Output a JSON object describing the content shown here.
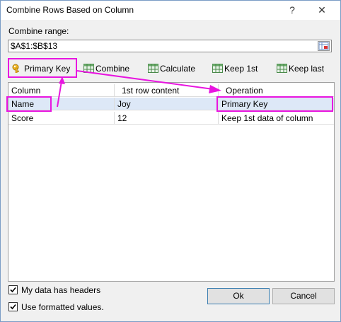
{
  "window": {
    "title": "Combine Rows Based on Column",
    "help": "?",
    "close": "✕"
  },
  "range": {
    "label": "Combine range:",
    "value": "$A$1:$B$13"
  },
  "toolbar": {
    "primary_key": "Primary Key",
    "combine": "Combine",
    "calculate": "Calculate",
    "keep_first": "Keep 1st",
    "keep_last": "Keep last"
  },
  "table": {
    "headers": [
      "Column",
      "1st row content",
      "Operation"
    ],
    "rows": [
      [
        "Name",
        "Joy",
        "Primary Key"
      ],
      [
        "Score",
        "12",
        "Keep 1st data of column"
      ]
    ]
  },
  "options": {
    "headers_label": "My data has headers",
    "headers_checked": true,
    "formatted_label": "Use formatted values.",
    "formatted_checked": true
  },
  "buttons": {
    "ok": "Ok",
    "cancel": "Cancel"
  },
  "colors": {
    "highlight": "#e815e0",
    "selected_row": "#dde8f7"
  }
}
